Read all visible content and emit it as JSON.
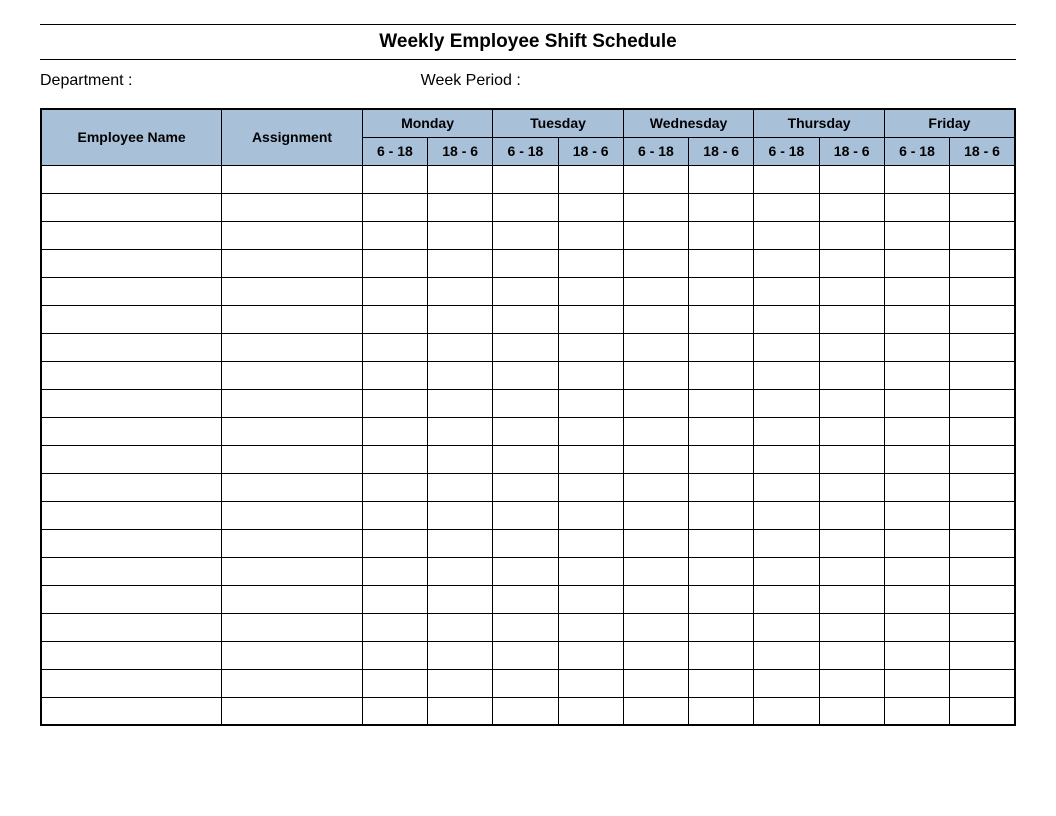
{
  "title": "Weekly Employee Shift Schedule",
  "meta": {
    "department_label": "Department :",
    "week_period_label": "Week  Period :"
  },
  "table": {
    "employee_name_header": "Employee Name",
    "assignment_header": "Assignment",
    "days": [
      "Monday",
      "Tuesday",
      "Wednesday",
      "Thursday",
      "Friday"
    ],
    "shifts": [
      "6 - 18",
      "18 - 6"
    ],
    "row_count": 20
  }
}
